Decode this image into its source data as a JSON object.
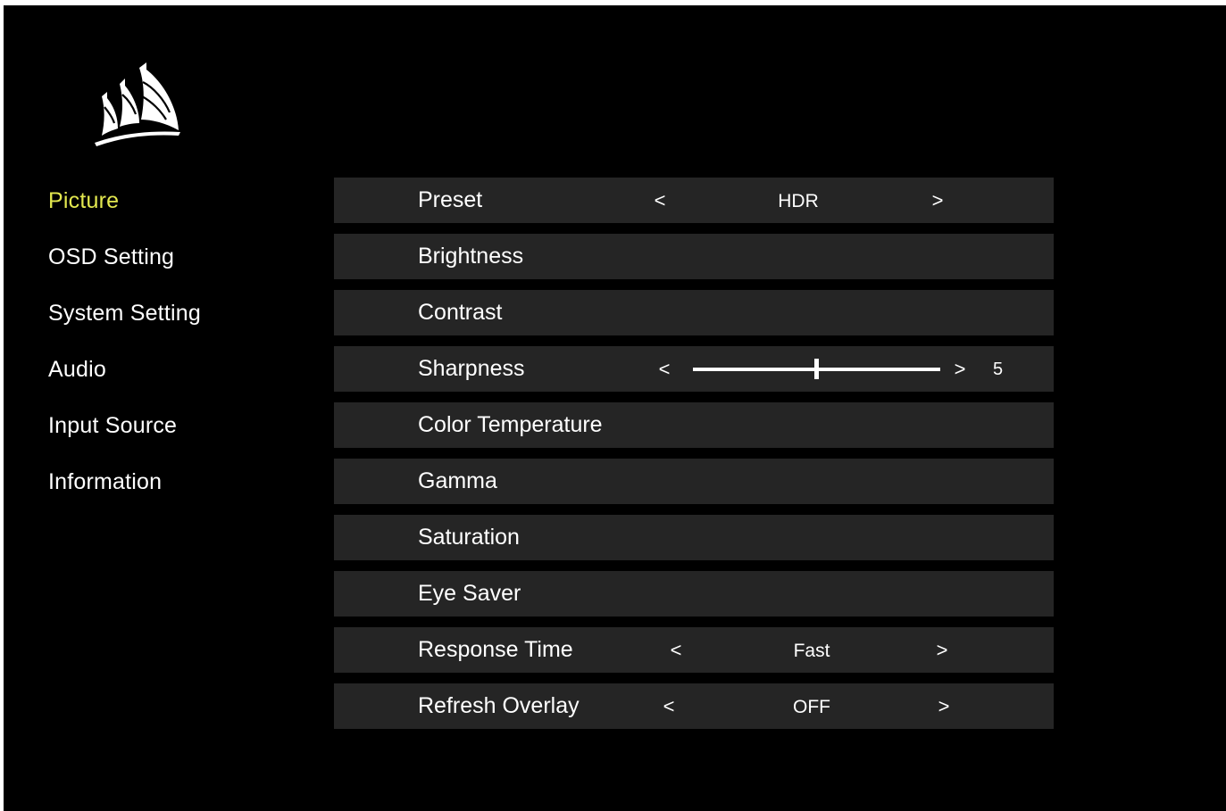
{
  "brand": {
    "logo_icon": "corsair-sails-logo-icon"
  },
  "sidebar": {
    "active_color": "#e3e84f",
    "items": [
      {
        "label": "Picture",
        "active": true
      },
      {
        "label": "OSD Setting",
        "active": false
      },
      {
        "label": "System Setting",
        "active": false
      },
      {
        "label": "Audio",
        "active": false
      },
      {
        "label": "Input Source",
        "active": false
      },
      {
        "label": "Information",
        "active": false
      }
    ]
  },
  "picture_menu": {
    "preset": {
      "label": "Preset",
      "prev": "<",
      "value": "HDR",
      "next": ">"
    },
    "brightness": {
      "label": "Brightness"
    },
    "contrast": {
      "label": "Contrast"
    },
    "sharpness": {
      "label": "Sharpness",
      "prev": "<",
      "next": ">",
      "value": "5",
      "level": 0.5
    },
    "color_temperature": {
      "label": "Color Temperature"
    },
    "gamma": {
      "label": "Gamma"
    },
    "saturation": {
      "label": "Saturation"
    },
    "eye_saver": {
      "label": "Eye Saver"
    },
    "response_time": {
      "label": "Response Time",
      "prev": "<",
      "value": "Fast",
      "next": ">"
    },
    "refresh_overlay": {
      "label": "Refresh Overlay",
      "prev": "<",
      "value": "OFF",
      "next": ">"
    }
  }
}
